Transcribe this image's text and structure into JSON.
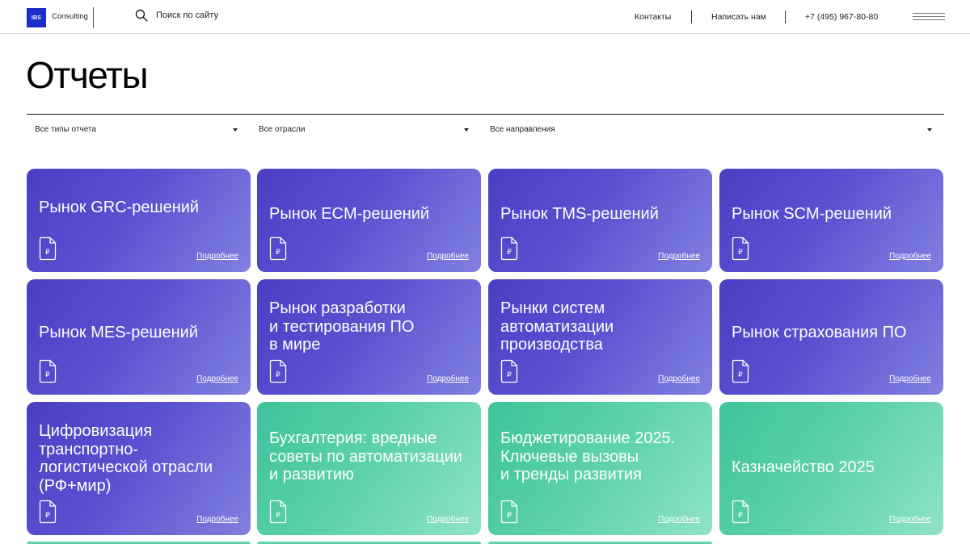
{
  "header": {
    "logo_mark": "IBS",
    "logo_text": "Consulting",
    "search_label": "Поиск по сайту",
    "contacts": "Контакты",
    "write_us": "Написать нам",
    "phone": "+7 (495) 967-80-80"
  },
  "page_title": "Отчеты",
  "filters": [
    {
      "label": "Все типы отчета"
    },
    {
      "label": "Все отрасли"
    },
    {
      "label": "Все направления"
    }
  ],
  "more_label": "Подробнее",
  "currency_glyph": "₽",
  "colors": {
    "violet_start": "#4a3fc4",
    "violet_end": "#8280e0",
    "green_start": "#3ec39a",
    "green_end": "#8fe3c6",
    "logo_blue": "#1a2ecc"
  },
  "cards": [
    {
      "title": "Рынок GRC-решений",
      "theme": "violet"
    },
    {
      "title": "Рынок ECM-решений",
      "theme": "violet"
    },
    {
      "title": "Рынок TMS-решений",
      "theme": "violet"
    },
    {
      "title": "Рынок SCM-решений",
      "theme": "violet"
    },
    {
      "title": "Рынок MES-решений",
      "theme": "violet"
    },
    {
      "title": "Рынок разработки\nи тестирования ПО\nв мире",
      "theme": "violet"
    },
    {
      "title": "Рынки систем\nавтоматизации\nпроизводства",
      "theme": "violet"
    },
    {
      "title": "Рынок страхования ПО",
      "theme": "violet"
    },
    {
      "title": "Цифровизация\nтранспортно-\nлогистической отрасли\n(РФ+мир)",
      "theme": "violet"
    },
    {
      "title": "Бухгалтерия: вредные\nсоветы по автоматизации\nи развитию",
      "theme": "green"
    },
    {
      "title": "Бюджетирование 2025.\nКлючевые вызовы\nи тренды развития",
      "theme": "green"
    },
    {
      "title": "Казначейство 2025",
      "theme": "green"
    }
  ]
}
